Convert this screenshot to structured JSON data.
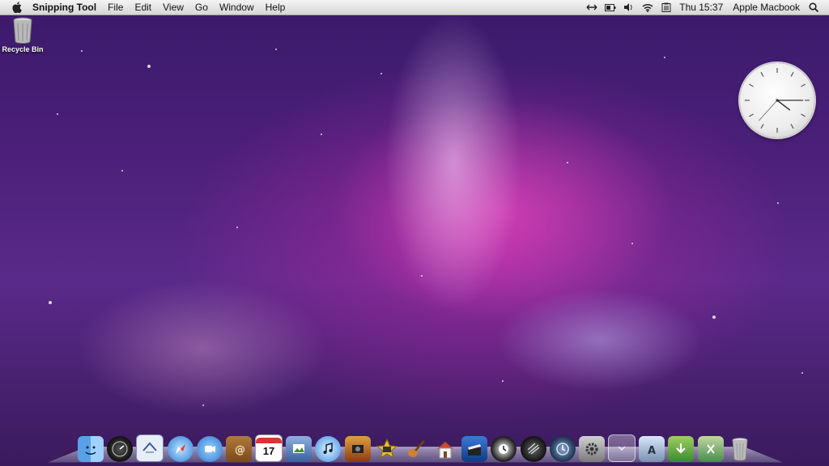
{
  "menubar": {
    "apple_icon": "apple-icon",
    "app_name": "Snipping Tool",
    "items": [
      "File",
      "Edit",
      "View",
      "Go",
      "Window",
      "Help"
    ],
    "status_icons": [
      "arrows-icon",
      "battery-icon",
      "volume-icon",
      "wifi-icon",
      "clipboard-icon"
    ],
    "clock": "Thu 15:37",
    "user": "Apple Macbook",
    "search_icon": "search-icon"
  },
  "desktop": {
    "icons": [
      {
        "label": "Recycle Bin",
        "icon": "trash-icon"
      }
    ]
  },
  "widgets": {
    "clock": {
      "hour": 4,
      "minute": 15,
      "second": 37
    }
  },
  "dock": {
    "items": [
      "finder-icon",
      "dashboard-icon",
      "mail-icon",
      "safari-icon",
      "ichat-icon",
      "address-book-icon",
      "calendar-icon",
      "iphoto-icon",
      "itunes-icon",
      "photo-booth-icon",
      "imovie-icon",
      "garageband-icon",
      "home-icon",
      "clapper-icon",
      "time-machine-icon",
      "front-row-icon",
      "time-machine-clock-icon",
      "system-preferences-icon",
      "blank-stack-icon",
      "applications-stack-icon",
      "downloads-stack-icon",
      "documents-stack-icon",
      "trash-icon"
    ],
    "calendar_day": "17"
  }
}
